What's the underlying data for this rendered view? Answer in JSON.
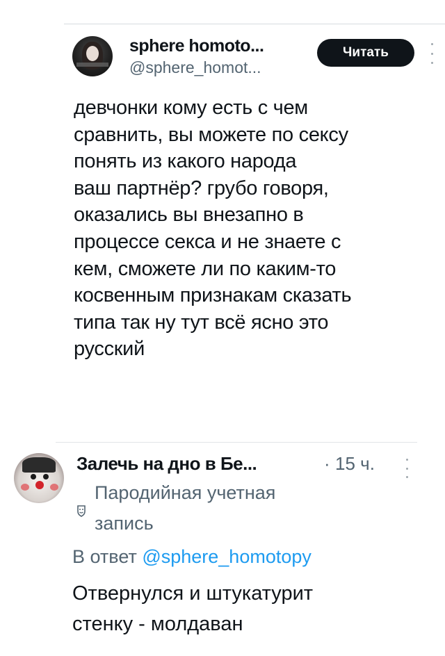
{
  "post": {
    "author_name": "sphere homoto...",
    "author_handle": "@sphere_homot...",
    "read_button": "Читать",
    "text_lines": [
      "девчонки кому есть с чем",
      "сравнить, вы можете по сексу",
      "понять из какого народа",
      "ваш партнёр? грубо говоря,",
      "оказались вы внезапно в",
      "процессе секса и не знаете с",
      "кем, сможете ли по каким-то",
      "косвенным признакам сказать",
      "типа так ну тут всё ясно это",
      "русский"
    ]
  },
  "reply": {
    "author_name": "Залечь на дно в Бе...",
    "separator": "·",
    "time": "15 ч.",
    "parody_label_line1": "Пародийная учетная",
    "parody_label_line2": "запись",
    "reply_to_prefix": "В ответ ",
    "reply_to_mention": "@sphere_homotopy",
    "text_lines": [
      "Отвернулся и штукатурит",
      "стенку - молдаван"
    ]
  },
  "icons": {
    "more": "more-vertical-icon",
    "parody": "parody-mask-icon"
  },
  "colors": {
    "text": "#0f1419",
    "secondary": "#536471",
    "link": "#1d9bf0",
    "button_bg": "#0f1419",
    "button_text": "#ffffff"
  }
}
